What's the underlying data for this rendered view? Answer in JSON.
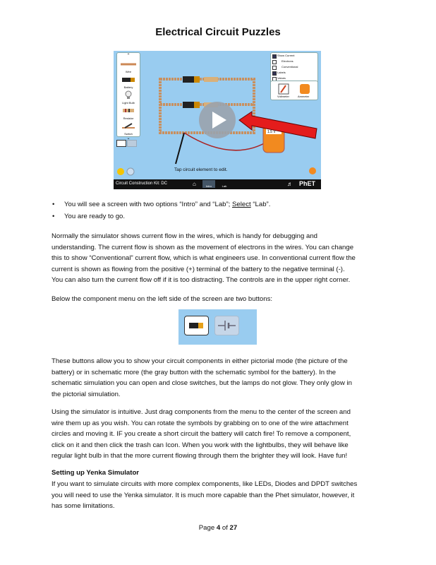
{
  "title": "Electrical Circuit Puzzles",
  "simulator": {
    "menu": [
      "Wire",
      "Battery",
      "Light Bulb",
      "Resistor",
      "Switch"
    ],
    "controls": [
      "Show Current",
      "Electrons",
      "Conventional",
      "Labels",
      "Values"
    ],
    "tools": [
      "Voltmeter",
      "Ammeter"
    ],
    "hint": "Tap circuit element to edit.",
    "bar_title": "Circuit Construction Kit: DC",
    "tabs": [
      "Intro",
      "Lab"
    ],
    "logo": "PhET",
    "meter_reading": "1.5 V"
  },
  "bullets": [
    {
      "pre": "You will see a screen with two options “Intro” and “Lab”; ",
      "u": "Select",
      "post": " “Lab”."
    },
    {
      "text": "You are ready to go."
    }
  ],
  "para1": [
    "Normally the simulator shows current flow in the wires, which is handy for debugging and",
    "understanding.  The current flow is shown as the movement of electrons in the wires.  You can change",
    "this to show “Conventional” current flow, which is what engineers use.  In conventional current flow the",
    "current is shown as flowing from the positive (+) terminal of the battery to the negative terminal (-).",
    "You can also turn the current flow off if it is too distracting.  The controls are in the upper right corner."
  ],
  "para2": "Below the component menu on the left side of the screen are two buttons:",
  "para3": [
    "These buttons allow you to show your circuit components in either pictorial mode (the picture of the",
    "battery) or in schematic more (the gray button with the schematic symbol for the battery).  In the",
    "schematic simulation you can open and close switches, but the lamps do not glow.  They only glow in",
    "the pictorial simulation."
  ],
  "para4": [
    "Using the simulator is intuitive.  Just drag components from the menu to the center of the screen and",
    "wire them up as you wish.  You can rotate the symbols by grabbing on to one of the wire attachment",
    "circles and moving it.  IF you create a short circuit the battery will catch fire!  To remove a component,",
    "click on it and then click the trash can Icon.  When you work with the lightbulbs, they will behave like",
    "regular light bulb in that the more current flowing through them the brighter they will look.  Have fun!"
  ],
  "section_heading": "Setting up Yenka Simulator",
  "para5": [
    "If you want to simulate circuits with more complex components, like LEDs, Diodes and DPDT switches",
    "you will need to use the Yenka simulator.  It is much more capable than the Phet simulator, however, it",
    "has some limitations."
  ],
  "footer": {
    "pre": "Page ",
    "page": "4",
    "mid": " of ",
    "total": "27"
  }
}
